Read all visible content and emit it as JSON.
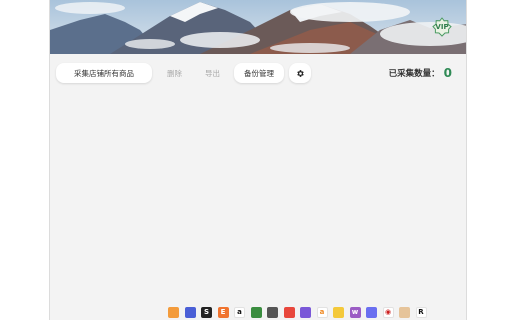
{
  "banner": {
    "vip_label": "VIP"
  },
  "toolbar": {
    "collect_label": "采集店铺所有商品",
    "delete_label": "删除",
    "export_label": "导出",
    "backup_label": "备份管理",
    "settings_icon": "gear-icon"
  },
  "stats": {
    "count_label": "已采集数量：",
    "count_value": "0"
  },
  "dock": [
    {
      "name": "shop-app-1-icon",
      "glyph": "",
      "bg": "#f39b3b",
      "fg": "#ffffff"
    },
    {
      "name": "shop-app-2-icon",
      "glyph": "",
      "bg": "#4a5fd6",
      "fg": "#ffffff"
    },
    {
      "name": "shop-app-s-icon",
      "glyph": "S",
      "bg": "#222222",
      "fg": "#ffffff"
    },
    {
      "name": "shop-app-e-icon",
      "glyph": "E",
      "bg": "#f0742f",
      "fg": "#ffffff"
    },
    {
      "name": "amazon-icon",
      "glyph": "a",
      "bg": "#ffffff",
      "fg": "#111111"
    },
    {
      "name": "shop-app-6-icon",
      "glyph": "",
      "bg": "#3a8d3f",
      "fg": "#ffffff"
    },
    {
      "name": "shop-app-7-icon",
      "glyph": "",
      "bg": "#555555",
      "fg": "#ffffff"
    },
    {
      "name": "shop-app-8-icon",
      "glyph": "",
      "bg": "#e8473c",
      "fg": "#ffffff"
    },
    {
      "name": "shop-app-9-icon",
      "glyph": "",
      "bg": "#7a58d8",
      "fg": "#ffffff"
    },
    {
      "name": "shop-app-a-icon",
      "glyph": "a",
      "bg": "#ffffff",
      "fg": "#f08a24"
    },
    {
      "name": "shop-app-11-icon",
      "glyph": "",
      "bg": "#f4c93a",
      "fg": "#ffffff"
    },
    {
      "name": "woo-icon",
      "glyph": "w",
      "bg": "#9b5cc4",
      "fg": "#ffffff"
    },
    {
      "name": "shop-app-13-icon",
      "glyph": "",
      "bg": "#6a6ff0",
      "fg": "#ffffff"
    },
    {
      "name": "target-icon",
      "glyph": "◉",
      "bg": "#ffffff",
      "fg": "#cc1f1f"
    },
    {
      "name": "shop-app-15-icon",
      "glyph": "",
      "bg": "#e6c49a",
      "fg": "#ffffff"
    },
    {
      "name": "shop-app-r-icon",
      "glyph": "R",
      "bg": "#ffffff",
      "fg": "#111111"
    }
  ]
}
